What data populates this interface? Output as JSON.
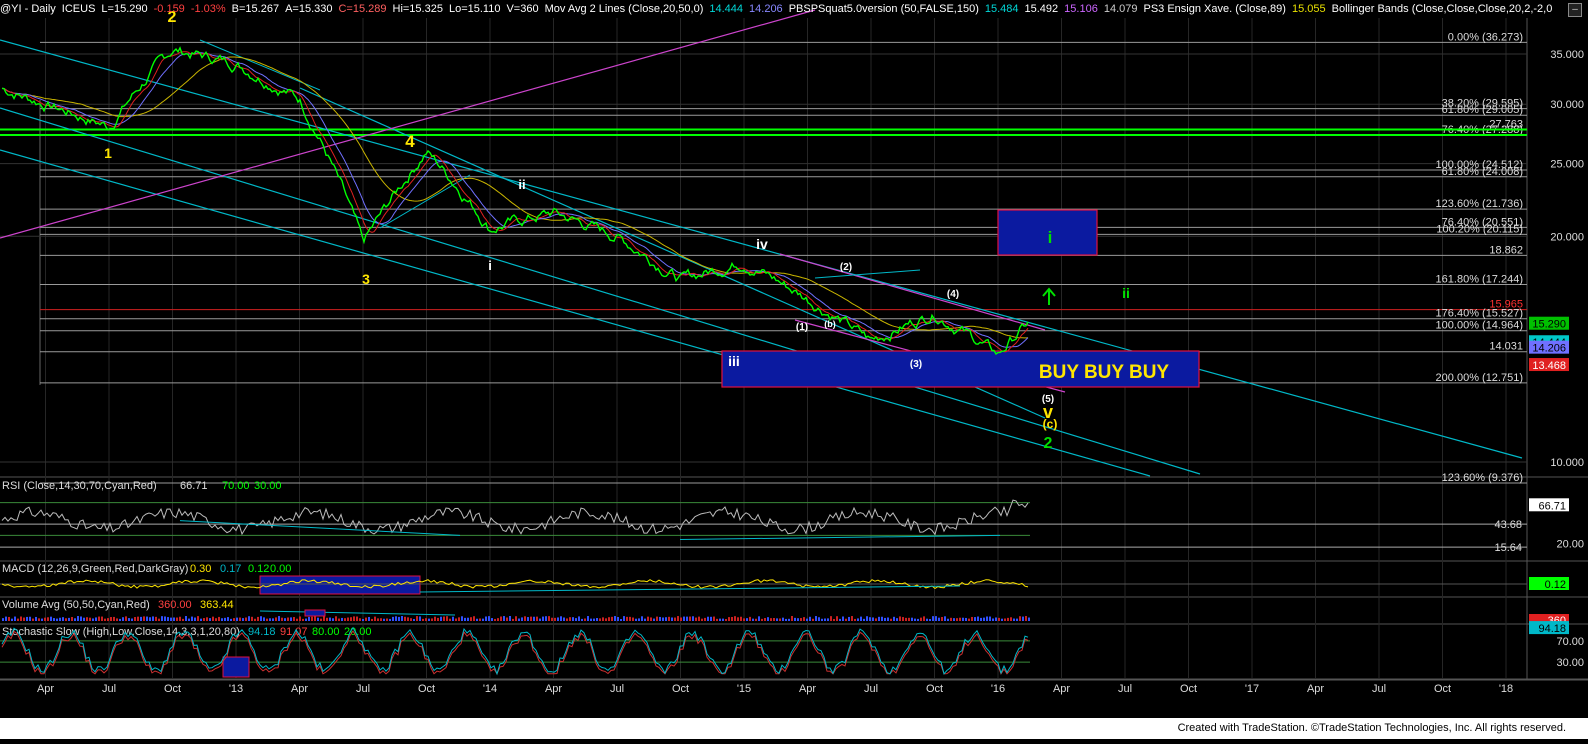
{
  "header": {
    "symbol": "@YI - Daily",
    "exchange": "ICEUS",
    "last": "L=15.290",
    "chg": "-0.159",
    "pct": "-1.03%",
    "bid": "B=15.267",
    "ask": "A=15.330",
    "close_val": "C=15.289",
    "high": "Hi=15.325",
    "low": "Lo=15.110",
    "vol": "V=360",
    "ma_label": "Mov Avg 2 Lines (Close,20,50,0)",
    "ma_v1": "14.444",
    "ma_v2": "14.206",
    "pbs_label": "PBSPSquat5.0version (50,FALSE,150)",
    "pbs_v1": "15.484",
    "pbs_v2": "15.492",
    "pbs_v3": "15.106",
    "pbs_v4": "14.079",
    "ps3_label": "PS3 Ensign Xave. (Close,89)",
    "ps3_v": "15.055",
    "bb_label": "Bollinger Bands (Close,Close,Close,20,2,-2,0"
  },
  "colors": {
    "price": "#00ff00",
    "teal": "#00b8c8",
    "magenta": "#cc44cc",
    "yellow_ma": "#c8b400",
    "red_ma": "#e02020",
    "blue_ma": "#7070ff",
    "fib": "#d0d0d0",
    "box_fill": "#0b1aa0",
    "box_border": "#e01040",
    "wave_yellow": "#ffe600",
    "wave_white": "#ffffff",
    "wave_green": "#00e000",
    "grid": "#333333"
  },
  "chart_data": [
    {
      "type": "line",
      "panel": "price",
      "ylim": [
        9.5,
        37.5
      ],
      "log_scale": true,
      "x": [
        "2012-02",
        "2012-04",
        "2012-07",
        "2012-10",
        "2013-01",
        "2013-04",
        "2013-07",
        "2013-10",
        "2014-01",
        "2014-04",
        "2014-07",
        "2014-10",
        "2015-01",
        "2015-04",
        "2015-07",
        "2015-10",
        "2016-01",
        "2016-02"
      ],
      "series": [
        {
          "values": [
            31.5,
            30.0,
            28.0,
            35.5,
            34.0,
            30.5,
            19.5,
            26.0,
            20.5,
            21.5,
            20.0,
            17.5,
            18.5,
            16.5,
            14.5,
            15.8,
            13.9,
            15.29
          ]
        }
      ],
      "y_ticks": [
        "35.000",
        "30.000",
        "25.000",
        "20.000",
        "10.000"
      ],
      "x_ticks": [
        "Apr",
        "Jul",
        "Oct",
        "'13",
        "Apr",
        "Jul",
        "Oct",
        "'14",
        "Apr",
        "Jul",
        "Oct",
        "'15",
        "Apr",
        "Jul",
        "Oct",
        "'16",
        "Apr",
        "Jul",
        "Oct",
        "'17",
        "Apr",
        "Jul",
        "Oct",
        "'18"
      ],
      "fib_levels": [
        {
          "label": "0.00% (36.273)",
          "value": 36.273
        },
        {
          "label": "38.20% (29.595)",
          "value": 29.595
        },
        {
          "label": "61.80% (29.005)",
          "value": 29.005
        },
        {
          "label": "27.763",
          "value": 27.763
        },
        {
          "label": "76.40% (27.288)",
          "value": 27.288
        },
        {
          "label": "100.00% (24.512)",
          "value": 24.512
        },
        {
          "label": "61.80% (24.008)",
          "value": 24.008
        },
        {
          "label": "123.60% (21.736)",
          "value": 21.736
        },
        {
          "label": "76.40% (20.551)",
          "value": 20.551
        },
        {
          "label": "100.20% (20.115)",
          "value": 20.115
        },
        {
          "label": "18.862",
          "value": 18.862
        },
        {
          "label": "161.80% (17.244)",
          "value": 17.244
        },
        {
          "label": "15.965",
          "value": 15.965
        },
        {
          "label": "176.40% (15.527)",
          "value": 15.527
        },
        {
          "label": "100.00% (14.964)",
          "value": 14.964
        },
        {
          "label": "14.031",
          "value": 14.031
        },
        {
          "label": "200.00% (12.751)",
          "value": 12.751
        },
        {
          "label": "123.60% (9.376)",
          "value": 9.376
        }
      ],
      "price_tags": [
        {
          "label": "15.290",
          "value": 15.29,
          "color": "#00c000"
        },
        {
          "label": "14.444",
          "value": 14.444,
          "color": "#00c8c8"
        },
        {
          "label": "14.206",
          "value": 14.206,
          "color": "#7070ff"
        },
        {
          "label": "13.468",
          "value": 13.468,
          "color": "#e02020"
        }
      ],
      "wave_labels": [
        {
          "text": "2",
          "color": "yellow"
        },
        {
          "text": "1",
          "color": "yellow"
        },
        {
          "text": "4",
          "color": "yellow"
        },
        {
          "text": "3",
          "color": "yellow"
        },
        {
          "text": "ii",
          "color": "white"
        },
        {
          "text": "i",
          "color": "white"
        },
        {
          "text": "iv",
          "color": "white"
        },
        {
          "text": "iii",
          "color": "white"
        },
        {
          "text": "(1)",
          "color": "white"
        },
        {
          "text": "(b)",
          "color": "white"
        },
        {
          "text": "(2)",
          "color": "white"
        },
        {
          "text": "(3)",
          "color": "white"
        },
        {
          "text": "(4)",
          "color": "white"
        },
        {
          "text": "(5)",
          "color": "white"
        },
        {
          "text": "v",
          "color": "yellow"
        },
        {
          "text": "(c)",
          "color": "yellow"
        },
        {
          "text": "2",
          "color": "green"
        },
        {
          "text": "i",
          "color": "green"
        },
        {
          "text": "ii",
          "color": "green"
        }
      ],
      "annotation": "BUY BUY BUY"
    },
    {
      "type": "line",
      "panel": "rsi",
      "title": "RSI (Close,14,30,70,Cyan,Red)",
      "values_text": [
        "66.71",
        "70.00",
        "30.00"
      ],
      "ylim": [
        0,
        100
      ],
      "y_ticks": [
        "20.00"
      ],
      "levels": [
        {
          "label": "43.68",
          "value": 43.68
        },
        {
          "label": "15.64",
          "value": 15.64
        }
      ],
      "last": {
        "label": "66.71",
        "value": 66.71
      }
    },
    {
      "type": "line",
      "panel": "macd",
      "title": "MACD (12,26,9,Green,Red,DarkGray)",
      "values_text": [
        "0.30",
        "0.17",
        "0.12",
        "0.00"
      ],
      "last": {
        "label": "0.12",
        "value": 0.12
      }
    },
    {
      "type": "bar",
      "panel": "volume",
      "title": "Volume Avg (50,50,Cyan,Red)",
      "values_text": [
        "360.00",
        "363.44"
      ],
      "last": {
        "label": "360",
        "value": 360
      }
    },
    {
      "type": "line",
      "panel": "stochastic",
      "title": "Stochastic Slow (High,Low,Close,14,3,3,1,20,80)",
      "values_text": [
        "94.18",
        "91.07",
        "80.00",
        "20.00"
      ],
      "ylim": [
        0,
        100
      ],
      "y_ticks": [
        "70.00",
        "30.00"
      ],
      "last": {
        "label": "94.18",
        "value": 94.18
      }
    }
  ],
  "footer": {
    "credit": "Created with TradeStation. ©TradeStation Technologies, Inc. All rights reserved."
  }
}
